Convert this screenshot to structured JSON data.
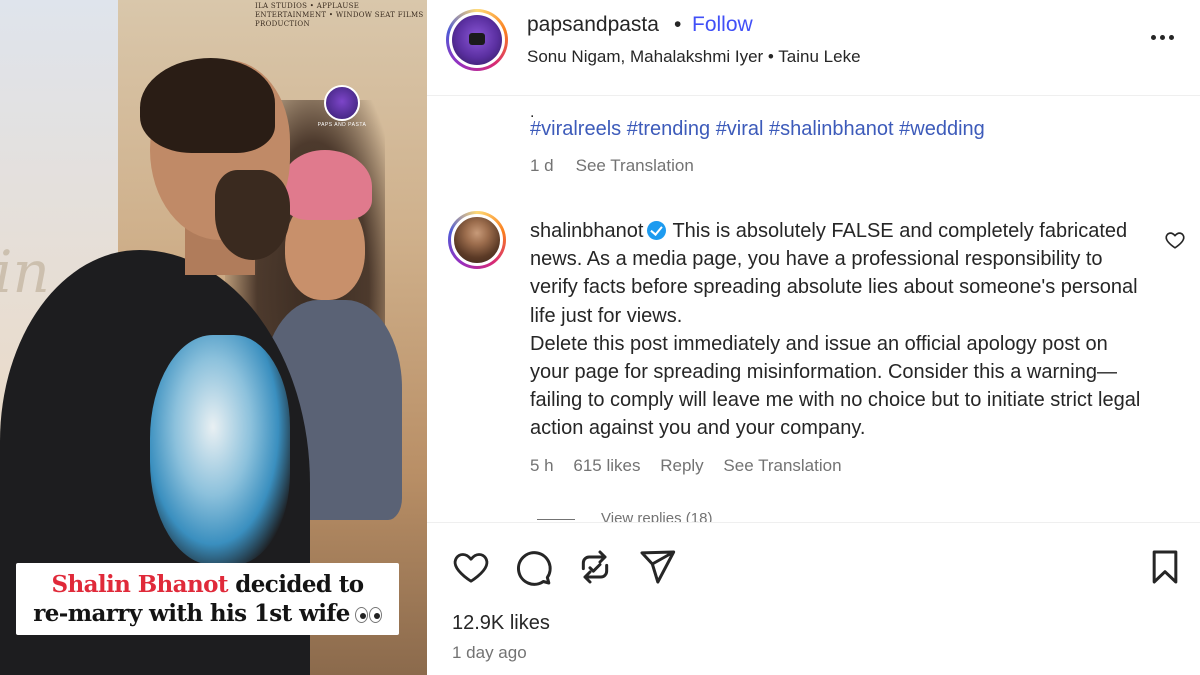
{
  "media": {
    "credits": "ILA STUDIOS • APPLAUSE ENTERTAINMENT • WINDOW SEAT FILMS PRODUCTION",
    "watermark_logo": "PAPS AND PASTA",
    "caption_red": "Shalin Bhanot",
    "caption_rest": " decided to",
    "caption_line2": "re-marry with his 1st wife",
    "background_letters": "in"
  },
  "post": {
    "username": "papsandpasta",
    "separator": "•",
    "follow_label": "Follow",
    "audio": "Sonu Nigam, Mahalakshmi Iyer • Tainu Leke",
    "more_icon": "more-horizontal-icon",
    "caption": {
      "stray_dot": ".",
      "hashtags": [
        "#viralreels",
        "#trending",
        "#viral",
        "#shalinbhanot",
        "#wedding"
      ],
      "age": "1 d",
      "see_translation": "See Translation"
    },
    "comment": {
      "username": "shalinbhanot",
      "text_line1": "This is absolutely FALSE and completely fabricated news. As a media page, you have a professional responsibility to verify facts before spreading absolute lies about someone's personal life just for views.",
      "text_line2": "Delete this post immediately and issue an official apology post on your page for spreading misinformation. Consider this a warning—failing to comply will leave me with no choice but to initiate strict legal action against you and your company.",
      "age": "5 h",
      "likes": "615 likes",
      "reply": "Reply",
      "see_translation": "See Translation",
      "view_replies": "View replies (18)"
    },
    "actions": {
      "likes_count": "12.9K likes",
      "time_ago": "1 day ago"
    }
  },
  "colors": {
    "link_blue": "#4150f7",
    "hashtag_blue": "#3d5bba",
    "secondary_text": "#737373",
    "verified_blue": "#1d9bf0",
    "caption_red": "#e02a3a"
  }
}
